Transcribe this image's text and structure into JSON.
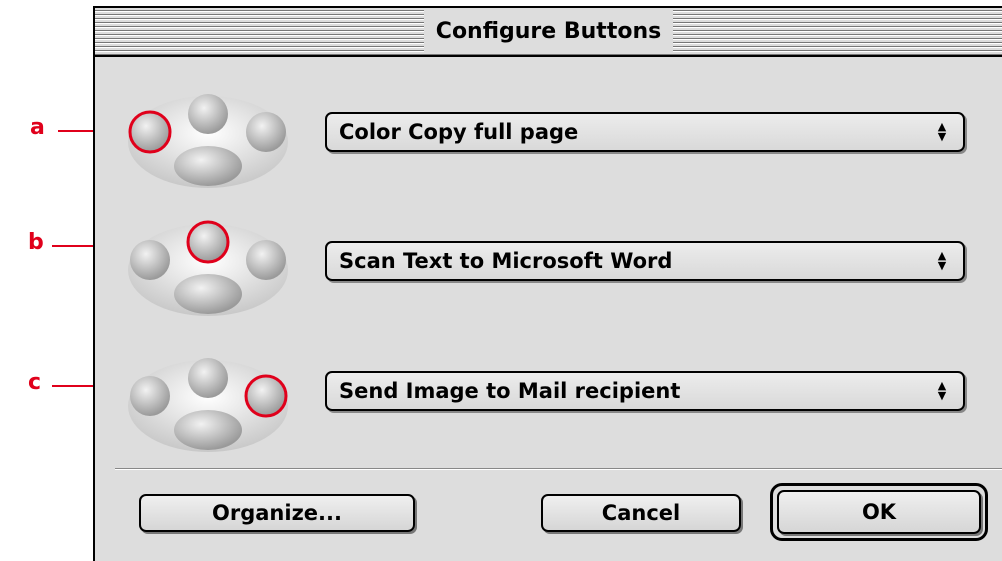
{
  "window": {
    "title": "Configure Buttons"
  },
  "rows": [
    {
      "letter": "a",
      "action": "Color Copy full page",
      "highlighted_button": "left"
    },
    {
      "letter": "b",
      "action": "Scan Text to Microsoft Word",
      "highlighted_button": "top"
    },
    {
      "letter": "c",
      "action": "Send Image to Mail recipient",
      "highlighted_button": "right"
    }
  ],
  "buttons": {
    "organize": "Organize...",
    "cancel": "Cancel",
    "ok": "OK"
  },
  "colors": {
    "callout": "#e0001b",
    "dialog_bg": "#dddddd"
  },
  "icons": {
    "paw": "scanner-button-cluster-icon",
    "popup_arrows": "updown-arrows-icon"
  }
}
